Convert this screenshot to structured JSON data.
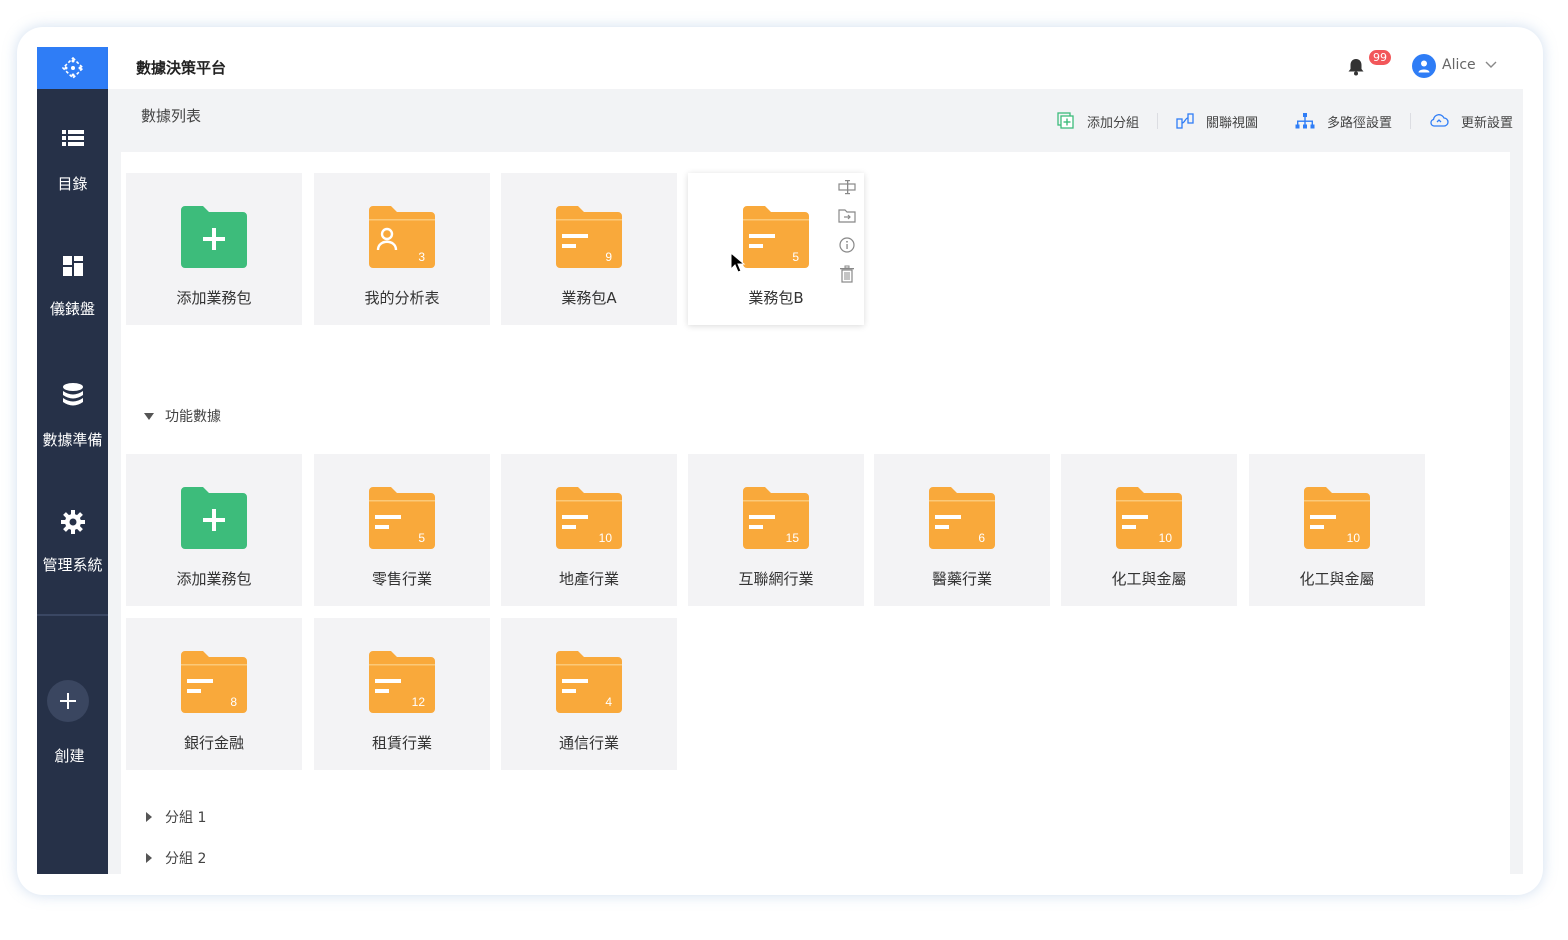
{
  "app": {
    "title": "數據決策平台"
  },
  "sidebar": {
    "items": [
      {
        "label": "目錄",
        "icon": "list-icon"
      },
      {
        "label": "儀錶盤",
        "icon": "dashboard-icon"
      },
      {
        "label": "數據準備",
        "icon": "database-icon"
      },
      {
        "label": "管理系統",
        "icon": "gear-icon"
      }
    ],
    "create_label": "創建"
  },
  "header": {
    "notifications": "99",
    "username": "Alice"
  },
  "page": {
    "title": "數據列表"
  },
  "toolbar": {
    "add_group": "添加分組",
    "relation_view": "關聯視圖",
    "multipath": "多路徑設置",
    "update_settings": "更新設置"
  },
  "top_cards": [
    {
      "label": "添加業務包",
      "type": "add"
    },
    {
      "label": "我的分析表",
      "type": "user",
      "count": "3"
    },
    {
      "label": "業務包A",
      "type": "folder",
      "count": "9"
    },
    {
      "label": "業務包B",
      "type": "folder",
      "count": "5"
    }
  ],
  "section": {
    "title": "功能數據",
    "cards": [
      {
        "label": "添加業務包",
        "type": "add"
      },
      {
        "label": "零售行業",
        "type": "folder",
        "count": "5"
      },
      {
        "label": "地產行業",
        "type": "folder",
        "count": "10"
      },
      {
        "label": "互聯網行業",
        "type": "folder",
        "count": "15"
      },
      {
        "label": "醫藥行業",
        "type": "folder",
        "count": "6"
      },
      {
        "label": "化工與金屬",
        "type": "folder",
        "count": "10"
      },
      {
        "label": "化工與金屬",
        "type": "folder",
        "count": "10"
      },
      {
        "label": "銀行金融",
        "type": "folder",
        "count": "8"
      },
      {
        "label": "租賃行業",
        "type": "folder",
        "count": "12"
      },
      {
        "label": "通信行業",
        "type": "folder",
        "count": "4"
      }
    ]
  },
  "groups": [
    {
      "label": "分組 1"
    },
    {
      "label": "分組 2"
    }
  ],
  "colors": {
    "sidebar": "#263148",
    "accent": "#2f7df6",
    "folder": "#f9a93b",
    "add": "#3dbc7b",
    "badge": "#f2575a"
  }
}
